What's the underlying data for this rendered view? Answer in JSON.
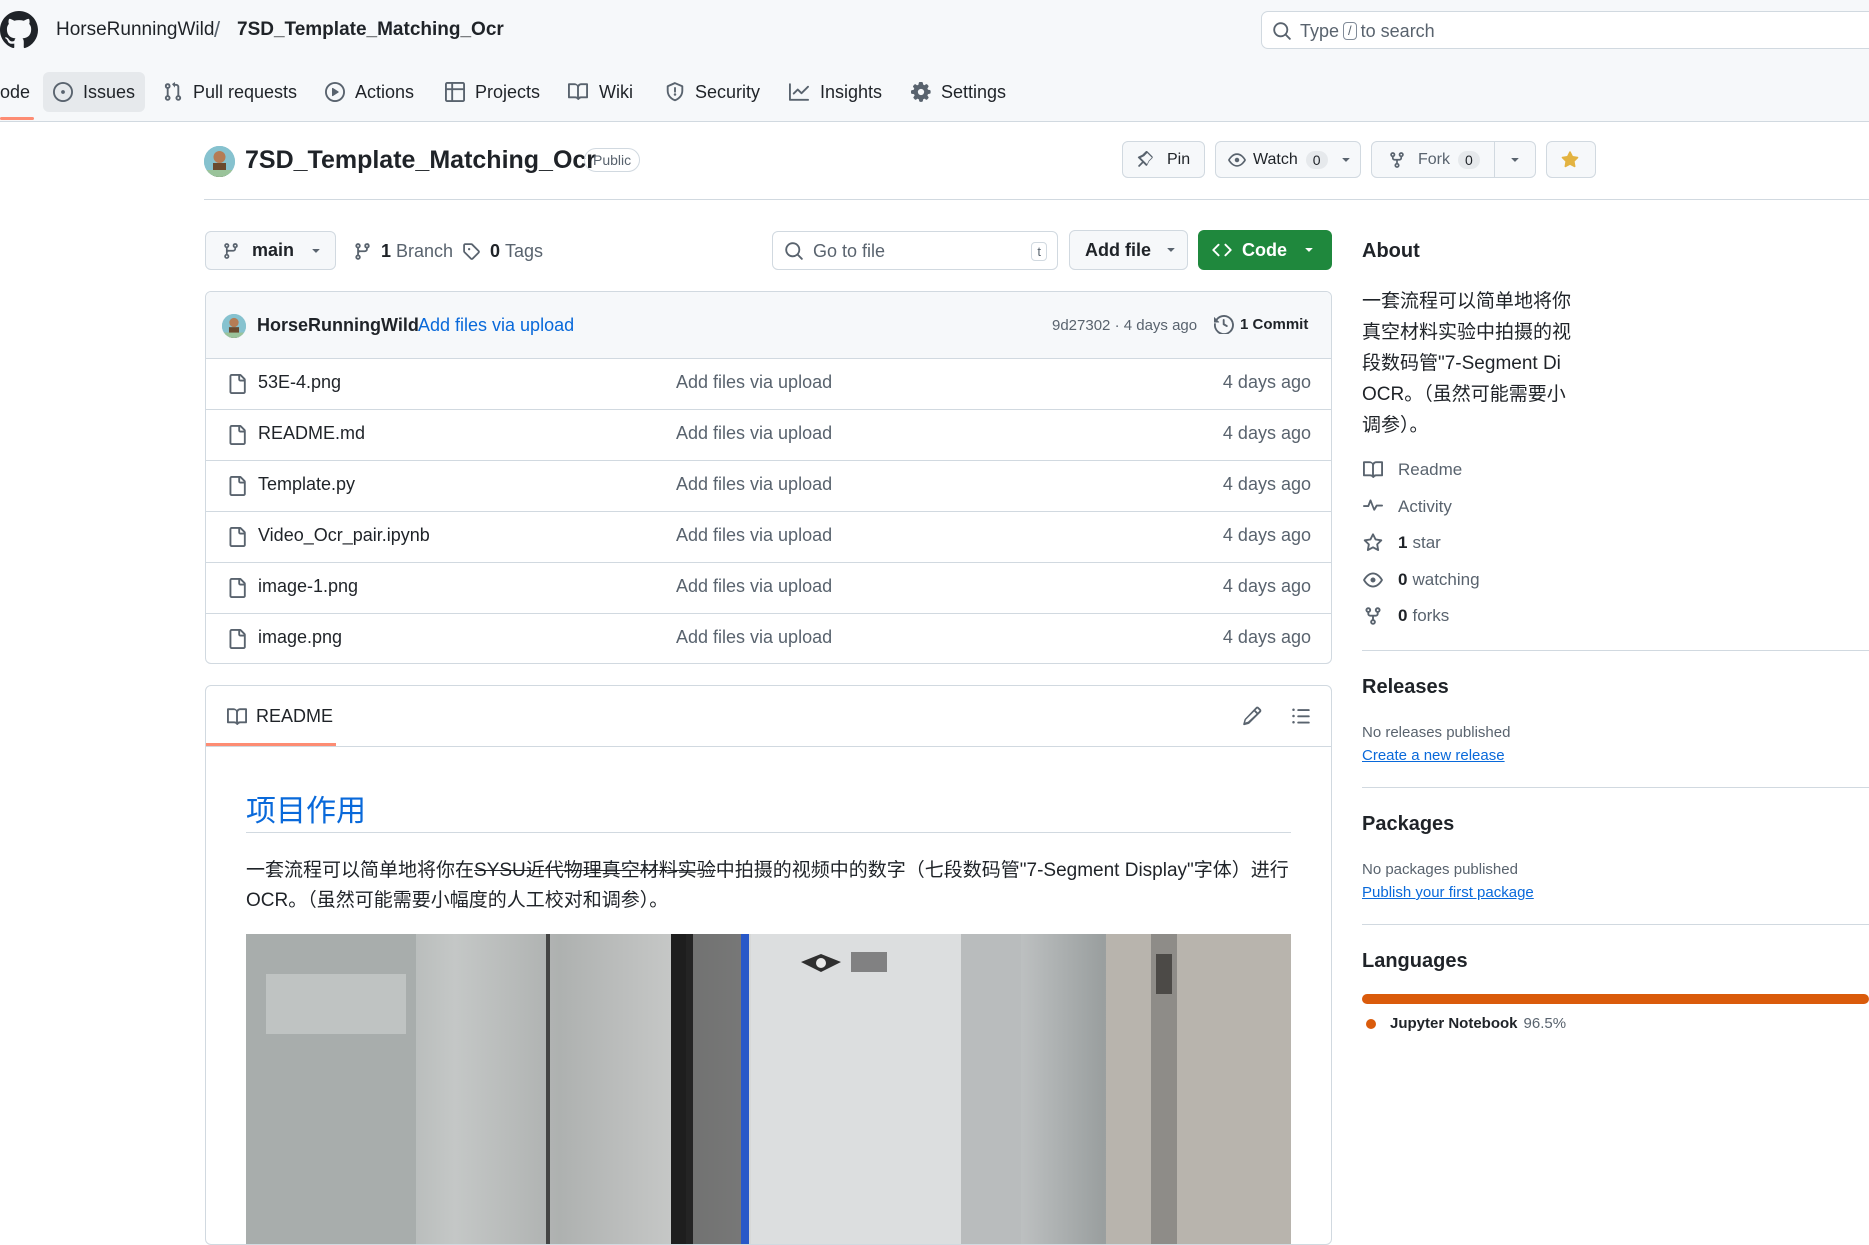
{
  "header": {
    "owner": "HorseRunningWild",
    "separator": "/",
    "repo": "7SD_Template_Matching_Ocr",
    "search_prefix": "Type",
    "search_key": "/",
    "search_suffix": "to search"
  },
  "nav": {
    "code_partial": "ode",
    "items": [
      "Issues",
      "Pull requests",
      "Actions",
      "Projects",
      "Wiki",
      "Security",
      "Insights",
      "Settings"
    ]
  },
  "repo_header": {
    "title": "7SD_Template_Matching_Ocr",
    "visibility": "Public",
    "pin": "Pin",
    "watch": "Watch",
    "watch_count": "0",
    "fork": "Fork",
    "fork_count": "0"
  },
  "branch_bar": {
    "branch": "main",
    "branches_count": "1",
    "branches_label": "Branch",
    "tags_count": "0",
    "tags_label": "Tags",
    "go_to_file": "Go to file",
    "go_to_file_key": "t",
    "add_file": "Add file",
    "code": "Code"
  },
  "latest_commit": {
    "author": "HorseRunningWild",
    "message": "Add files via upload",
    "meta": "9d27302 · 4 days ago",
    "commits": "1 Commit"
  },
  "files": [
    {
      "name": "53E-4.png",
      "message": "Add files via upload",
      "date": "4 days ago"
    },
    {
      "name": "README.md",
      "message": "Add files via upload",
      "date": "4 days ago"
    },
    {
      "name": "Template.py",
      "message": "Add files via upload",
      "date": "4 days ago"
    },
    {
      "name": "Video_Ocr_pair.ipynb",
      "message": "Add files via upload",
      "date": "4 days ago"
    },
    {
      "name": "image-1.png",
      "message": "Add files via upload",
      "date": "4 days ago"
    },
    {
      "name": "image.png",
      "message": "Add files via upload",
      "date": "4 days ago"
    }
  ],
  "readme": {
    "tab": "README",
    "heading": "项目作用",
    "para_before": "一套流程可以简单地将你在",
    "para_struck": "SYSU近代物理真空材料实验",
    "para_after": "中拍摄的视频中的数字（七段数码管\"7-Segment Display\"字体）进行OCR。（虽然可能需要小幅度的人工校对和调参）。"
  },
  "sidebar": {
    "about_title": "About",
    "about_text": "一套流程可以简单地将你\n真空材料实验中拍摄的视\n段数码管\"7-Segment Di\nOCR。（虽然可能需要小\n调参）。",
    "readme": "Readme",
    "activity": "Activity",
    "stars_count": "1",
    "stars_label": "star",
    "watching_count": "0",
    "watching_label": "watching",
    "forks_count": "0",
    "forks_label": "forks",
    "releases_title": "Releases",
    "releases_none": "No releases published",
    "releases_link": "Create a new release",
    "packages_title": "Packages",
    "packages_none": "No packages published",
    "packages_link": "Publish your first package",
    "languages_title": "Languages",
    "language_first": "Jupyter Notebook",
    "language_first_pct": "96.5%"
  },
  "colors": {
    "accent_green": "#1f883d",
    "link_blue": "#0969da",
    "tab_underline": "#fd8c73",
    "jupyter_orange": "#da5b0b"
  }
}
